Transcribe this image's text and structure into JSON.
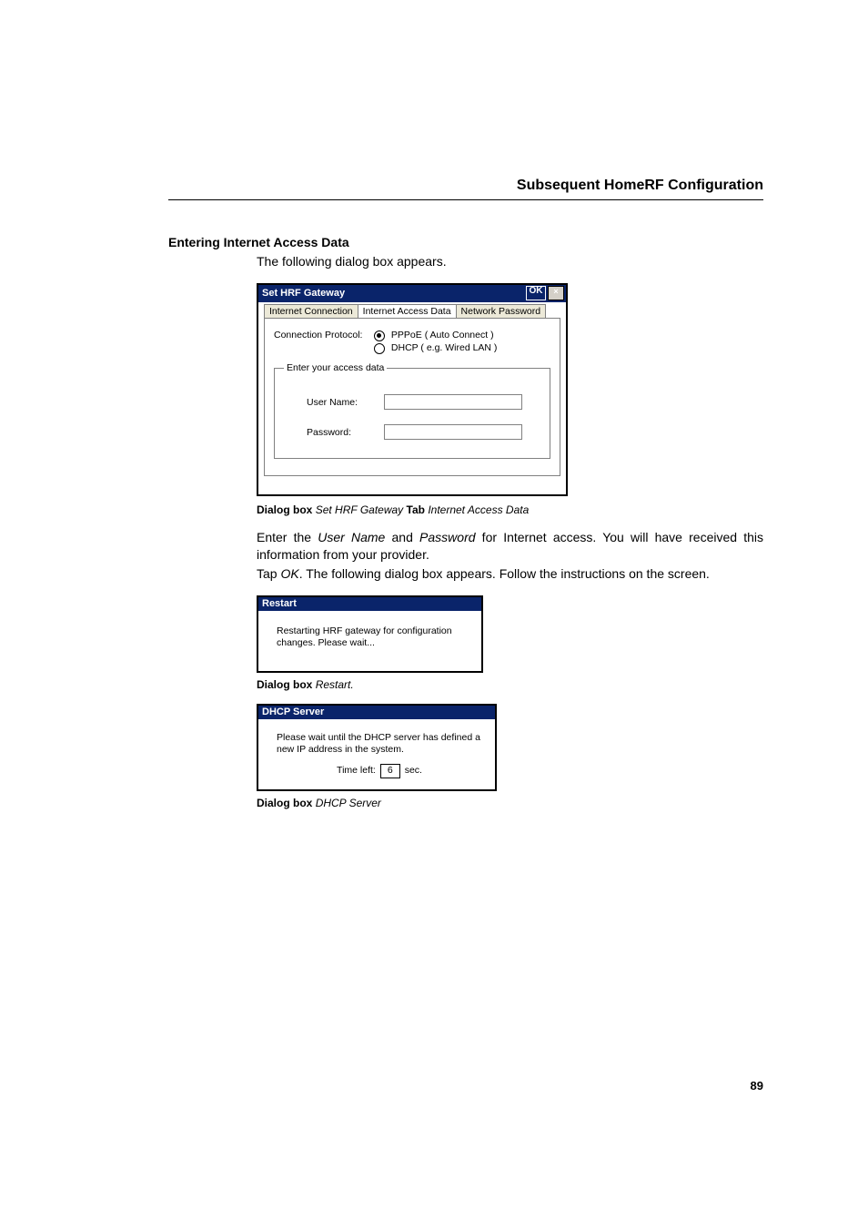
{
  "header": {
    "title": "Subsequent HomeRF Configuration"
  },
  "section_heading": "Entering Internet Access Data",
  "intro_text": "The following dialog box appears.",
  "dlg1": {
    "title": "Set HRF Gateway",
    "ok": "OK",
    "close": "×",
    "tabs": {
      "t0": "Internet Connection",
      "t1": "Internet Access Data",
      "t2": "Network Password"
    },
    "proto_label": "Connection Protocol:",
    "opt1": "PPPoE  ( Auto Connect )",
    "opt2": "DHCP   ( e.g. Wired LAN )",
    "fieldset_legend": "Enter your access data",
    "user_label": "User Name:",
    "pass_label": "Password:"
  },
  "caption1": {
    "p1": "Dialog box",
    "p2": "Set HRF Gateway",
    "p3": "Tab",
    "p4": "Internet Access Data"
  },
  "para2": {
    "l1a": "Enter the ",
    "l1b": "User Name",
    "l1c": " and ",
    "l1d": "Password",
    "l1e": " for Internet access. You will have received this information from your provider.",
    "l2a": "Tap ",
    "l2b": "OK",
    "l2c": ". The following dialog box appears. Follow the instructions on the screen."
  },
  "dlg2": {
    "title": "Restart",
    "body": "Restarting HRF gateway for configuration changes. Please wait..."
  },
  "caption2": {
    "p1": "Dialog box",
    "p2": "Restart."
  },
  "dlg3": {
    "title": "DHCP Server",
    "body": "Please wait until the DHCP server has defined a new IP address in the system.",
    "timeleft_label": "Time left:",
    "timeleft_value": "6",
    "timeleft_unit": "sec."
  },
  "caption3": {
    "p1": "Dialog box",
    "p2": "DHCP Server"
  },
  "page_number": "89"
}
